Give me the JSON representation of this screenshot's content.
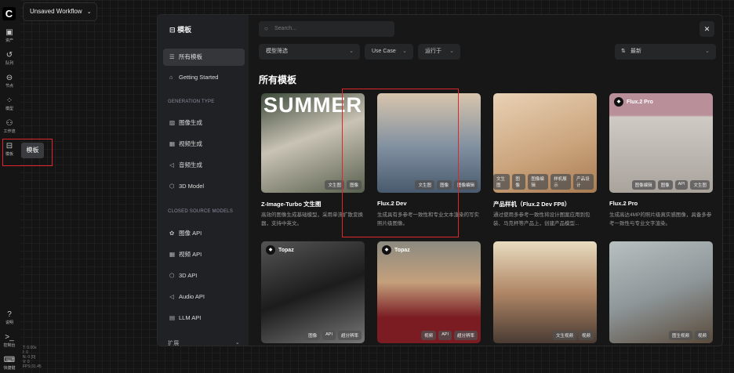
{
  "app": {
    "logo": "C",
    "workflow_title": "Unsaved Workflow"
  },
  "rail": {
    "items": [
      {
        "icon": "assets-icon",
        "label": "资产"
      },
      {
        "icon": "queue-icon",
        "label": "队列"
      },
      {
        "icon": "nodes-icon",
        "label": "节点"
      },
      {
        "icon": "models-icon",
        "label": "模型"
      },
      {
        "icon": "workflow-icon",
        "label": "工作流"
      },
      {
        "icon": "templates-icon",
        "label": "模板"
      }
    ],
    "bottom": [
      {
        "icon": "help-icon",
        "label": "说明"
      },
      {
        "icon": "console-icon",
        "label": "控制台"
      },
      {
        "icon": "keyboard-icon",
        "label": "快捷键"
      }
    ],
    "tooltip": "模板",
    "stats": [
      "T: 0.00s",
      "I: 0",
      "N: 0 [0]",
      "V: 0",
      "FPS:31.45"
    ]
  },
  "modal": {
    "sidebar": {
      "title": "模板",
      "items": [
        {
          "label": "所有模板",
          "icon": "list-icon",
          "active": true
        },
        {
          "label": "Getting Started",
          "icon": "graduation-icon"
        }
      ],
      "sections": [
        {
          "title": "GENERATION TYPE",
          "items": [
            {
              "label": "图像生成",
              "icon": "image-icon"
            },
            {
              "label": "视频生成",
              "icon": "film-icon"
            },
            {
              "label": "音频生成",
              "icon": "audio-icon"
            },
            {
              "label": "3D Model",
              "icon": "cube-icon"
            }
          ]
        },
        {
          "title": "CLOSED SOURCE MODELS",
          "items": [
            {
              "label": "图像 API",
              "icon": "image-api-icon"
            },
            {
              "label": "视频 API",
              "icon": "film-icon"
            },
            {
              "label": "3D API",
              "icon": "cube-icon"
            },
            {
              "label": "Audio API",
              "icon": "audio-icon"
            },
            {
              "label": "LLM API",
              "icon": "chat-icon"
            }
          ]
        }
      ],
      "expand": "扩展"
    },
    "search_placeholder": "Search...",
    "filters": [
      "模型筛选",
      "Use Case",
      "运行于"
    ],
    "sort": "最新",
    "heading": "所有模板",
    "cards": [
      {
        "title": "Z-Image-Turbo 文生图",
        "desc": "高效的图像生成基础模型，采用单流扩散变换器，支持中英文。",
        "tags": [
          "文生图",
          "图像"
        ],
        "overlay": "SUMMER"
      },
      {
        "title": "Flux.2 Dev",
        "desc": "生成具有多参考一致性和专业文本渲染的写实照片级图像。",
        "tags": [
          "文生图",
          "图像",
          "图像编辑"
        ]
      },
      {
        "title": "产品样机（Flux.2 Dev FP8）",
        "desc": "通过使用多参考一致性将设计图案应用到包装、马克杯等产品上，创建产品模型...",
        "tags": [
          "文生图",
          "图像",
          "图像编辑",
          "样机展示",
          "产品设计"
        ]
      },
      {
        "title": "Flux.2 Pro",
        "desc": "生成高达4MP的照片级真实感图像，具备多参考一致性与专业文字渲染。",
        "tags": [
          "图像编辑",
          "图像",
          "API",
          "文生图"
        ],
        "badge": "Flux.2 Pro"
      },
      {
        "tags": [
          "图像",
          "API",
          "超分辨率"
        ],
        "badge": "Topaz"
      },
      {
        "tags": [
          "视频",
          "API",
          "超分辨率"
        ],
        "badge": "Topaz"
      },
      {
        "tags": [
          "文生视频",
          "视频"
        ]
      },
      {
        "tags": [
          "图生视频",
          "视频"
        ]
      }
    ]
  }
}
